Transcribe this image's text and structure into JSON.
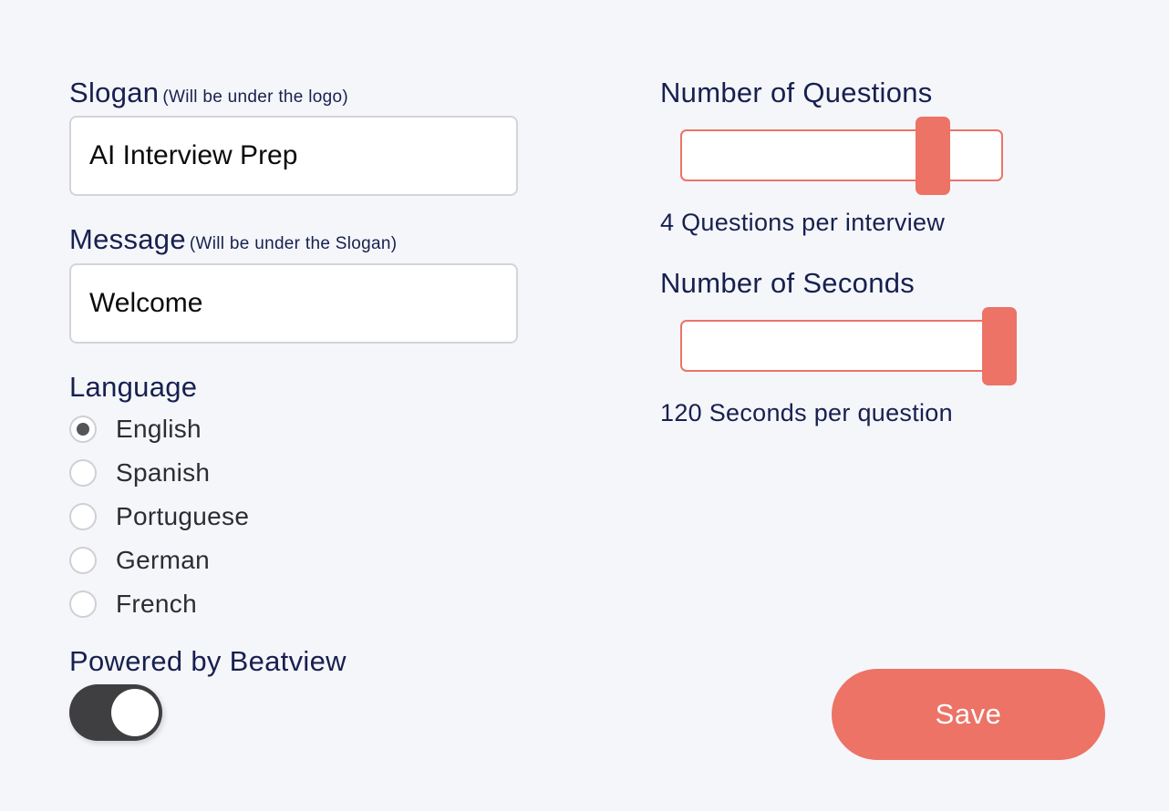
{
  "slogan": {
    "label": "Slogan",
    "hint": "(Will be under the logo)",
    "value": "AI Interview Prep"
  },
  "message": {
    "label": "Message",
    "hint": "(Will be under the Slogan)",
    "value": "Welcome"
  },
  "language": {
    "label": "Language",
    "selected": "English",
    "options": [
      {
        "label": "English",
        "checked": true
      },
      {
        "label": "Spanish",
        "checked": false
      },
      {
        "label": "Portuguese",
        "checked": false
      },
      {
        "label": "German",
        "checked": false
      },
      {
        "label": "French",
        "checked": false
      }
    ]
  },
  "powered_by": {
    "label": "Powered by Beatview",
    "enabled": true
  },
  "questions": {
    "label": "Number of Questions",
    "value": 4,
    "slider_fraction": 0.79,
    "summary": "4 Questions per interview"
  },
  "seconds": {
    "label": "Number of Seconds",
    "value": 120,
    "slider_fraction": 1.0,
    "summary": "120 Seconds per question"
  },
  "actions": {
    "save_label": "Save"
  },
  "colors": {
    "accent": "#ec7366",
    "heading": "#17204f",
    "background": "#f5f6fa",
    "toggle_on": "#3f3f41"
  }
}
